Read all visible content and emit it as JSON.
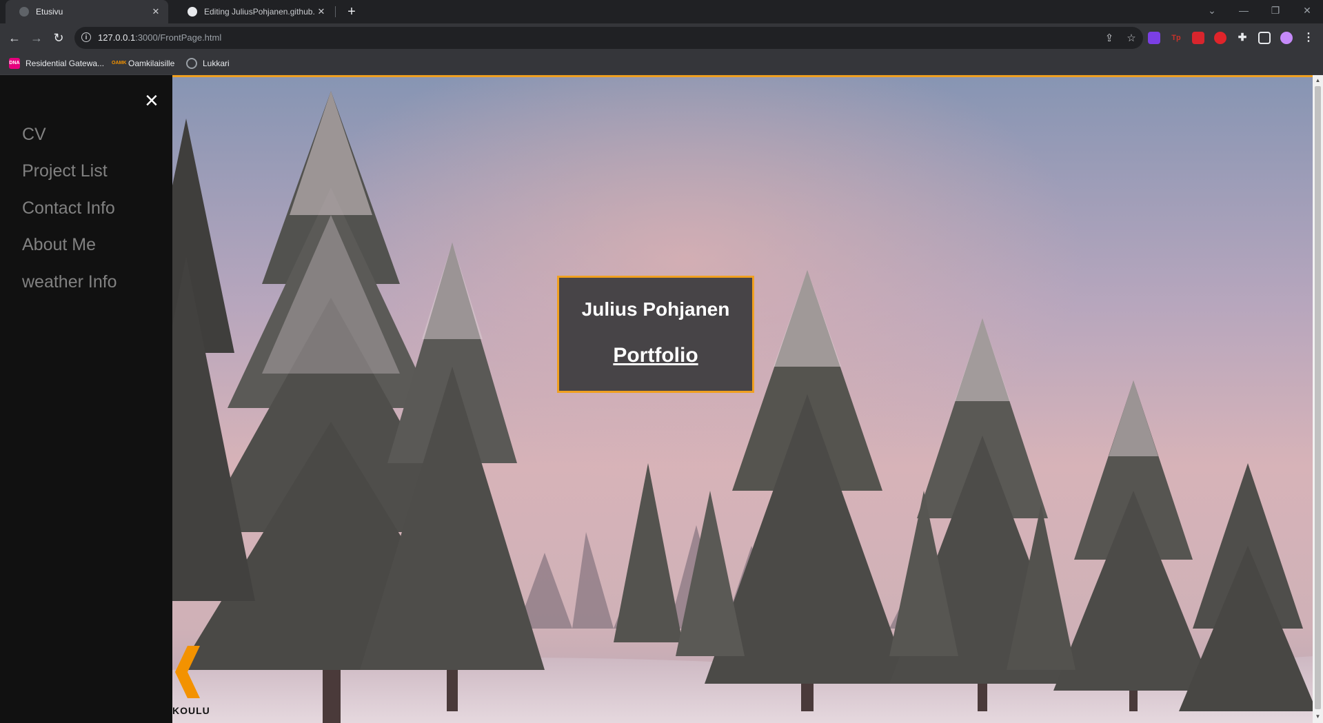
{
  "browser": {
    "tabs": [
      {
        "title": "Etusivu",
        "active": true
      },
      {
        "title": "Editing JuliusPohjanen.github.io/",
        "active": false
      }
    ],
    "address": {
      "host": "127.0.0.1",
      "path": ":3000/FrontPage.html"
    },
    "bookmarks": [
      {
        "label": "Residential Gatewa...",
        "icon_text": "DNA",
        "icon_color": "#e6007e"
      },
      {
        "label": "Oamkilaisille",
        "icon_text": "OAMK",
        "icon_color": "#f39200"
      },
      {
        "label": "Lukkari",
        "icon_text": "",
        "icon_color": "#9aa0a6"
      }
    ],
    "extensions": [
      {
        "icon": "shield-extension-icon",
        "text": "",
        "color": "#7b3fe4"
      },
      {
        "icon": "tp-extension-icon",
        "text": "Tp",
        "color": "#c7332a"
      },
      {
        "icon": "acrobat-extension-icon",
        "text": "",
        "color": "#d8252d"
      },
      {
        "icon": "hand-extension-icon",
        "text": "",
        "color": "#e0242a"
      }
    ]
  },
  "page": {
    "close_glyph": "×",
    "nav": [
      {
        "label": "CV"
      },
      {
        "label": "Project List"
      },
      {
        "label": "Contact Info"
      },
      {
        "label": "About Me"
      },
      {
        "label": "weather Info"
      }
    ],
    "title_box": {
      "name": "Julius Pohjanen",
      "link": "Portfolio"
    },
    "logo_word": "KOULU",
    "accent_color": "#f0a020"
  }
}
